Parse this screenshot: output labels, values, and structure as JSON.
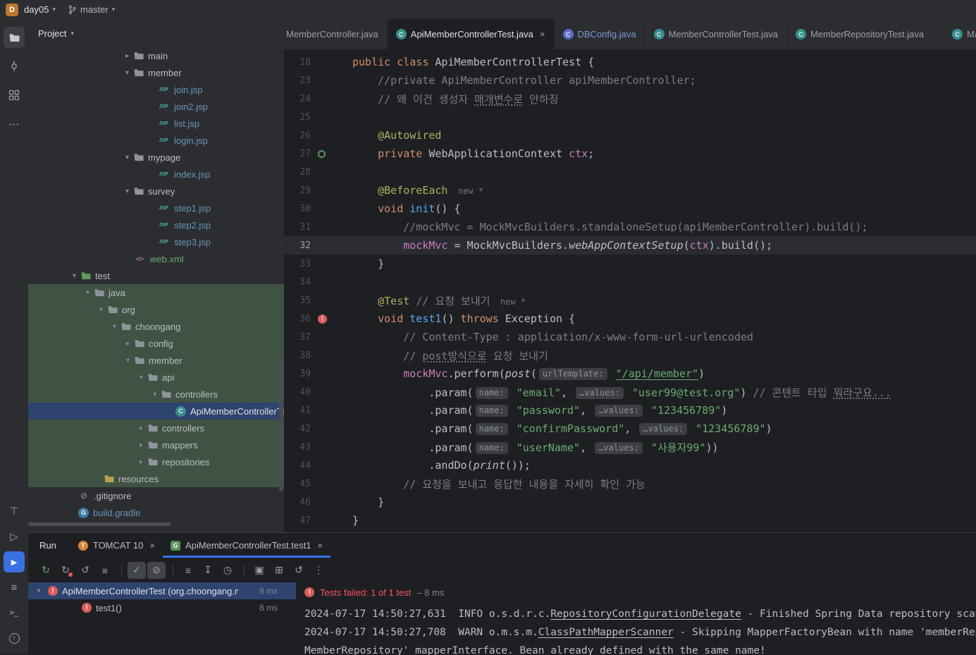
{
  "icons": {
    "chevron_down": "▾",
    "chevron_right": "▸",
    "close": "×",
    "more": "⋯",
    "overflow": "⋮",
    "servers": "⊤",
    "services": "▷",
    "run": "▶",
    "build": "≡",
    "terminal": ">_",
    "problems": "!"
  },
  "colors": {
    "accent_blue": "#3574f0",
    "selection_blue": "#2e436e",
    "test_source_green": "#405243",
    "error_red": "#db5c5c",
    "failed_text_red": "#f75464"
  },
  "titlebar": {
    "logo": "D",
    "project": "day05",
    "branch": "master"
  },
  "project_panel": {
    "header": "Project",
    "tree": [
      {
        "label": "main",
        "icon": "folder",
        "chev": "closed",
        "pad": 132
      },
      {
        "label": "member",
        "icon": "folder",
        "chev": "open",
        "pad": 132
      },
      {
        "label": "join.jsp",
        "icon": "jsp",
        "pad": 166,
        "color": "mod"
      },
      {
        "label": "join2.jsp",
        "icon": "jsp",
        "pad": 166,
        "color": "mod"
      },
      {
        "label": "list.jsp",
        "icon": "jsp",
        "pad": 166,
        "color": "mod"
      },
      {
        "label": "login.jsp",
        "icon": "jsp",
        "pad": 166,
        "color": "mod"
      },
      {
        "label": "mypage",
        "icon": "folder",
        "chev": "open",
        "pad": 132
      },
      {
        "label": "index.jsp",
        "icon": "jsp",
        "pad": 166,
        "color": "mod"
      },
      {
        "label": "survey",
        "icon": "folder",
        "chev": "open",
        "pad": 132
      },
      {
        "label": "step1.jsp",
        "icon": "jsp",
        "pad": 166,
        "color": "mod"
      },
      {
        "label": "step2.jsp",
        "icon": "jsp",
        "pad": 166,
        "color": "mod"
      },
      {
        "label": "step3.jsp",
        "icon": "jsp",
        "pad": 166,
        "color": "mod"
      },
      {
        "label": "web.xml",
        "icon": "xml",
        "pad": 132,
        "color": "green"
      },
      {
        "label": "test",
        "icon": "folder-test",
        "chev": "open",
        "pad": 57
      },
      {
        "label": "java",
        "icon": "folder",
        "chev": "open",
        "pad": 76,
        "bg": "src"
      },
      {
        "label": "org",
        "icon": "package",
        "chev": "open",
        "pad": 95,
        "bg": "src"
      },
      {
        "label": "choongang",
        "icon": "package",
        "chev": "open",
        "pad": 114,
        "bg": "src"
      },
      {
        "label": "config",
        "icon": "package",
        "chev": "closed",
        "pad": 133,
        "bg": "src"
      },
      {
        "label": "member",
        "icon": "package",
        "chev": "open",
        "pad": 133,
        "bg": "src"
      },
      {
        "label": "api",
        "icon": "package",
        "chev": "open",
        "pad": 152,
        "bg": "src"
      },
      {
        "label": "controllers",
        "icon": "package",
        "chev": "open",
        "pad": 171,
        "bg": "src"
      },
      {
        "label": "ApiMemberControllerTest",
        "icon": "class",
        "pad": 192,
        "bg": "sel"
      },
      {
        "label": "controllers",
        "icon": "package",
        "chev": "closed",
        "pad": 152,
        "bg": "src"
      },
      {
        "label": "mappers",
        "icon": "package",
        "chev": "closed",
        "pad": 152,
        "bg": "src"
      },
      {
        "label": "repositories",
        "icon": "package",
        "chev": "closed",
        "pad": 152,
        "bg": "src"
      },
      {
        "label": "resources",
        "icon": "folder-res",
        "pad": 90,
        "bg": "src"
      },
      {
        "label": ".gitignore",
        "icon": "gitignore",
        "pad": 54
      },
      {
        "label": "build.gradle",
        "icon": "gradle",
        "pad": 54,
        "color": "mod"
      }
    ]
  },
  "editor": {
    "tabs": [
      {
        "label": "MemberController.java",
        "icon": "class",
        "clip": "left"
      },
      {
        "label": "ApiMemberControllerTest.java",
        "icon": "class",
        "active": true,
        "close": true
      },
      {
        "label": "DBConfig.java",
        "icon": "class-blue",
        "color": "#7a9bd8"
      },
      {
        "label": "MemberControllerTest.java",
        "icon": "class"
      },
      {
        "label": "MemberRepositoryTest.java",
        "icon": "class"
      },
      {
        "label": "Ma",
        "icon": "class",
        "clip": "right"
      }
    ],
    "lines": [
      {
        "n": "18",
        "tk": [
          [
            "public class ",
            "kw"
          ],
          [
            "ApiMemberControllerTest {",
            "def"
          ]
        ]
      },
      {
        "n": "23",
        "tk": [
          [
            "    ",
            "def"
          ],
          [
            "//private ApiMemberController apiMemberController;",
            "cmt"
          ]
        ]
      },
      {
        "n": "24",
        "tk": [
          [
            "    ",
            "def"
          ],
          [
            "// 왜 이건 생성자 ",
            "cmt"
          ],
          [
            "매개변수로",
            "cmtu"
          ],
          [
            " 안하징",
            "cmt"
          ]
        ]
      },
      {
        "n": "25",
        "tk": []
      },
      {
        "n": "26",
        "tk": [
          [
            "    ",
            "def"
          ],
          [
            "@Autowired",
            "ann"
          ]
        ]
      },
      {
        "n": "27",
        "g": "spring",
        "tk": [
          [
            "    ",
            "def"
          ],
          [
            "private ",
            "kw"
          ],
          [
            "WebApplicationContext ",
            "def"
          ],
          [
            "ctx",
            "fld"
          ],
          [
            ";",
            "def"
          ]
        ]
      },
      {
        "n": "28",
        "tk": []
      },
      {
        "n": "29",
        "tk": [
          [
            "    ",
            "def"
          ],
          [
            "@BeforeEach",
            "ann"
          ],
          [
            "  new *",
            "hint"
          ]
        ]
      },
      {
        "n": "30",
        "tk": [
          [
            "    ",
            "def"
          ],
          [
            "void ",
            "kw"
          ],
          [
            "init",
            "mth"
          ],
          [
            "() {",
            "def"
          ]
        ]
      },
      {
        "n": "31",
        "tk": [
          [
            "        ",
            "def"
          ],
          [
            "//mockMvc = MockMvcBuilders.standaloneSetup(apiMemberController).build();",
            "cmt"
          ]
        ]
      },
      {
        "n": "32",
        "hl": true,
        "tk": [
          [
            "        ",
            "def"
          ],
          [
            "mockMvc",
            "fld"
          ],
          [
            " = MockMvcBuilders.",
            "def"
          ],
          [
            "webAppContextSetup",
            "stc"
          ],
          [
            "(",
            "def"
          ],
          [
            "ctx",
            "fld"
          ],
          [
            ").build();",
            "def"
          ]
        ]
      },
      {
        "n": "33",
        "tk": [
          [
            "    }",
            "def"
          ]
        ]
      },
      {
        "n": "34",
        "tk": []
      },
      {
        "n": "35",
        "tk": [
          [
            "    ",
            "def"
          ],
          [
            "@Test ",
            "ann"
          ],
          [
            "// 요청 보내기",
            "cmt"
          ],
          [
            "  new *",
            "hint"
          ]
        ]
      },
      {
        "n": "36",
        "g": "fail",
        "tk": [
          [
            "    ",
            "def"
          ],
          [
            "void ",
            "kw"
          ],
          [
            "test1",
            "mth"
          ],
          [
            "() ",
            "def"
          ],
          [
            "throws ",
            "kw"
          ],
          [
            "Exception {",
            "def"
          ]
        ]
      },
      {
        "n": "37",
        "tk": [
          [
            "        ",
            "def"
          ],
          [
            "// Content-Type : application/x-www-form-url-urlencoded",
            "cmt"
          ]
        ]
      },
      {
        "n": "38",
        "tk": [
          [
            "        ",
            "def"
          ],
          [
            "// ",
            "cmt"
          ],
          [
            "post방식으로",
            "cmtu"
          ],
          [
            " 요청 보내기",
            "cmt"
          ]
        ]
      },
      {
        "n": "39",
        "tk": [
          [
            "        ",
            "def"
          ],
          [
            "mockMvc",
            "fld"
          ],
          [
            ".perform(",
            "def"
          ],
          [
            "post",
            "stc"
          ],
          [
            "(",
            "def"
          ],
          [
            "urlTemplate:",
            "chip"
          ],
          [
            " ",
            "def"
          ],
          [
            "\"/api/member\"",
            "stru"
          ],
          [
            ")",
            "def"
          ]
        ]
      },
      {
        "n": "40",
        "tk": [
          [
            "            .param(",
            "def"
          ],
          [
            "name:",
            "chip"
          ],
          [
            " ",
            "def"
          ],
          [
            "\"email\"",
            "str"
          ],
          [
            ", ",
            "def"
          ],
          [
            "…values:",
            "chip"
          ],
          [
            " ",
            "def"
          ],
          [
            "\"user99@test.org\"",
            "str"
          ],
          [
            ") ",
            "def"
          ],
          [
            "// 콘텐트 타입 ",
            "cmt"
          ],
          [
            "뭐라구요...",
            "cmtu"
          ]
        ]
      },
      {
        "n": "41",
        "tk": [
          [
            "            .param(",
            "def"
          ],
          [
            "name:",
            "chip"
          ],
          [
            " ",
            "def"
          ],
          [
            "\"password\"",
            "str"
          ],
          [
            ", ",
            "def"
          ],
          [
            "…values:",
            "chip"
          ],
          [
            " ",
            "def"
          ],
          [
            "\"123456789\"",
            "str"
          ],
          [
            ")",
            "def"
          ]
        ]
      },
      {
        "n": "42",
        "tk": [
          [
            "            .param(",
            "def"
          ],
          [
            "name:",
            "chip"
          ],
          [
            " ",
            "def"
          ],
          [
            "\"confirmPassword\"",
            "str"
          ],
          [
            ", ",
            "def"
          ],
          [
            "…values:",
            "chip"
          ],
          [
            " ",
            "def"
          ],
          [
            "\"123456789\"",
            "str"
          ],
          [
            ")",
            "def"
          ]
        ]
      },
      {
        "n": "43",
        "tk": [
          [
            "            .param(",
            "def"
          ],
          [
            "name:",
            "chip"
          ],
          [
            " ",
            "def"
          ],
          [
            "\"userName\"",
            "str"
          ],
          [
            ", ",
            "def"
          ],
          [
            "…values:",
            "chip"
          ],
          [
            " ",
            "def"
          ],
          [
            "\"사용자99\"",
            "str"
          ],
          [
            "))",
            "def"
          ]
        ]
      },
      {
        "n": "44",
        "tk": [
          [
            "            .andDo(",
            "def"
          ],
          [
            "print",
            "stc"
          ],
          [
            "());",
            "def"
          ]
        ]
      },
      {
        "n": "45",
        "tk": [
          [
            "        ",
            "def"
          ],
          [
            "// 요청을 보내고 응답한 내용을 자세히 확인 가능",
            "cmt"
          ]
        ]
      },
      {
        "n": "46",
        "tk": [
          [
            "    }",
            "def"
          ]
        ]
      },
      {
        "n": "47",
        "tk": [
          [
            "}",
            "def"
          ]
        ]
      }
    ]
  },
  "run_panel": {
    "title": "Run",
    "tabs": [
      {
        "label": "TOMCAT 10",
        "icon": "tomcat",
        "close": true
      },
      {
        "label": "ApiMemberControllerTest.test1",
        "icon": "gradle-test",
        "close": true,
        "active": true
      }
    ],
    "toolbar": [
      {
        "name": "rerun",
        "glyph": "↻",
        "color": "#6aab73"
      },
      {
        "name": "rerun-failed-tests",
        "glyph": "↻",
        "color": "#9da0a8",
        "dot": true
      },
      {
        "name": "toggle-auto-test",
        "glyph": "↺",
        "color": "#9da0a8"
      },
      {
        "name": "stop",
        "glyph": "■",
        "color": "#5a5d63"
      },
      {
        "sep": true
      },
      {
        "name": "show-passed",
        "glyph": "✓",
        "color": "#73bd79",
        "pressed": true
      },
      {
        "name": "show-ignored",
        "glyph": "⊘",
        "color": "#9da0a8",
        "pressed": true
      },
      {
        "sep": true
      },
      {
        "name": "sort-alphabetically",
        "glyph": "≡",
        "color": "#9da0a8"
      },
      {
        "name": "navigate-to-failed",
        "glyph": "↧",
        "color": "#9da0a8"
      },
      {
        "name": "test-history",
        "glyph": "◷",
        "color": "#9da0a8"
      },
      {
        "sep": true
      },
      {
        "name": "screenshot",
        "glyph": "▣",
        "color": "#9da0a8"
      },
      {
        "name": "import-tests",
        "glyph": "⊞",
        "color": "#9da0a8"
      },
      {
        "name": "rerun-with-options",
        "glyph": "↺",
        "color": "#9da0a8"
      },
      {
        "name": "more-options",
        "glyph": "⋮",
        "color": "#9da0a8"
      }
    ],
    "test_tree": [
      {
        "label": "ApiMemberControllerTest (org.choongang.me",
        "duration": "8 ms",
        "selected": true,
        "chevron": true
      },
      {
        "label": "test1()",
        "duration": "8 ms",
        "indent": true
      }
    ],
    "status": {
      "label": "Tests failed:",
      "counts": "1 of 1 test",
      "duration": "– 8 ms"
    },
    "console": [
      {
        "pre": "2024-07-17 14:50:27,631  INFO o.s.d.r.c.",
        "link": "RepositoryConfigurationDelegate",
        "post": " - Finished Spring Data repository scan"
      },
      {
        "pre": "2024-07-17 14:50:27,708  WARN o.m.s.m.",
        "link": "ClassPathMapperScanner",
        "post": " - Skipping MapperFactoryBean with name 'memberRep"
      },
      {
        "pre": "MemberRepository' mapperInterface. Bean already defined with the same name!",
        "link": "",
        "post": ""
      }
    ]
  }
}
